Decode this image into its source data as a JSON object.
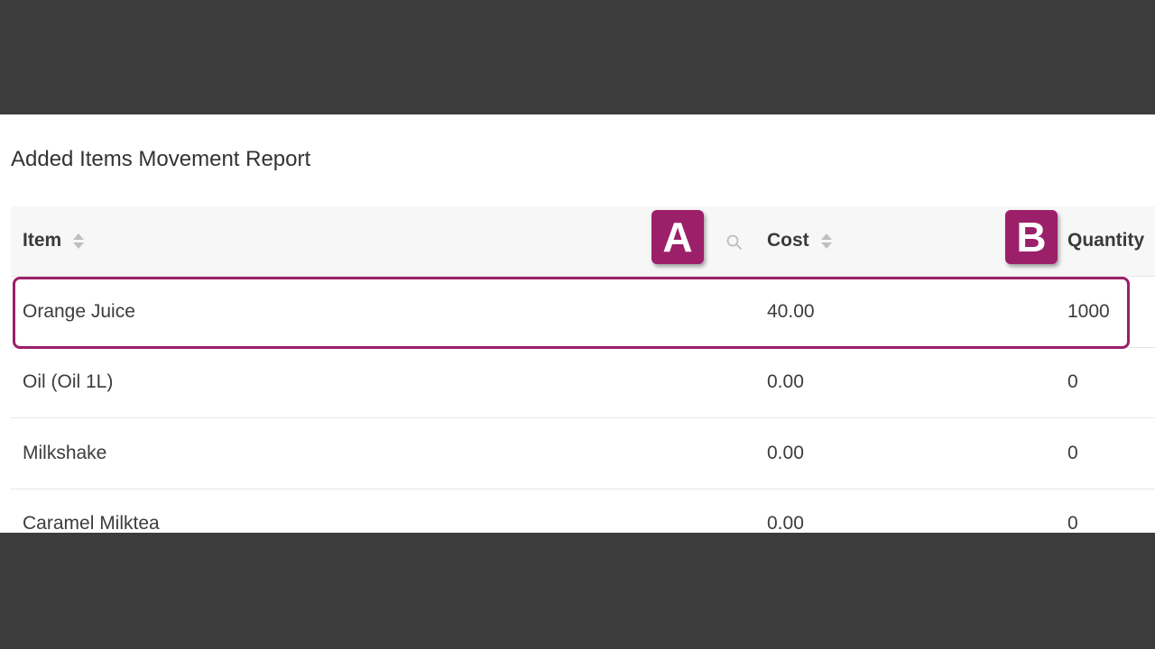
{
  "report": {
    "title": "Added Items Movement Report"
  },
  "table": {
    "columns": [
      {
        "label": "Item"
      },
      {
        "label": "Cost"
      },
      {
        "label": "Quantity"
      }
    ],
    "rows": [
      {
        "item": "Orange Juice",
        "cost": "40.00",
        "quantity": "1000"
      },
      {
        "item": "Oil (Oil 1L)",
        "cost": "0.00",
        "quantity": "0"
      },
      {
        "item": "Milkshake",
        "cost": "0.00",
        "quantity": "0"
      },
      {
        "item": "Caramel Milktea",
        "cost": "0.00",
        "quantity": "0"
      }
    ]
  },
  "annotations": {
    "badge_a": "A",
    "badge_b": "B",
    "accent_color": "#9c1f6a",
    "highlighted_row": "Orange Juice"
  }
}
